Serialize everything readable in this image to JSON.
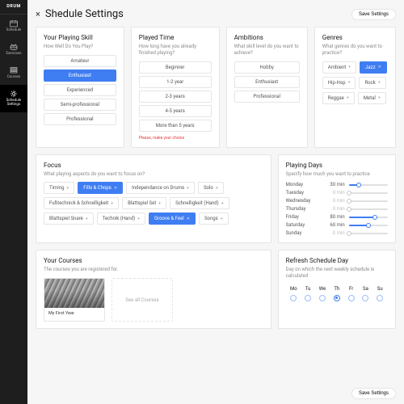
{
  "sidebar": {
    "logo": "DRUM",
    "items": [
      {
        "label": "Schedule"
      },
      {
        "label": "Exercises"
      },
      {
        "label": "Courses"
      },
      {
        "label": "Schedule\nSettings"
      }
    ]
  },
  "header": {
    "title": "Shedule Settings",
    "save_label": "Save Settings"
  },
  "skill": {
    "title": "Your Playing Skill",
    "subtitle": "How Well Do You Play?",
    "options": [
      "Amateur",
      "Enthusiast",
      "Experienced",
      "Semi-professional",
      "Professional"
    ],
    "selected": "Enthusiast"
  },
  "played": {
    "title": "Played Time",
    "subtitle": "How long have you already finished playing?",
    "options": [
      "Beginner",
      "1-2 year",
      "2-3 years",
      "4-5 years",
      "More than 5 years"
    ],
    "required_note": "Please, make your choice"
  },
  "ambitions": {
    "title": "Ambitions",
    "subtitle": "What skill level do you want to achieve?",
    "options": [
      "Hobby",
      "Enthusiast",
      "Professional"
    ]
  },
  "genres": {
    "title": "Genres",
    "subtitle": "What genres do you want to practice?",
    "tags": [
      {
        "label": "Ambient",
        "selected": false
      },
      {
        "label": "Jazz",
        "selected": true
      },
      {
        "label": "Hip-Hop",
        "selected": false
      },
      {
        "label": "Rock",
        "selected": false
      },
      {
        "label": "Reggae",
        "selected": false
      },
      {
        "label": "Metal",
        "selected": false
      }
    ]
  },
  "focus": {
    "title": "Focus",
    "subtitle": "What playing aspects do you want to focus on?",
    "tags": [
      {
        "label": "Timing",
        "selected": false
      },
      {
        "label": "Fills & Chops",
        "selected": true
      },
      {
        "label": "Independance on Drums",
        "selected": false
      },
      {
        "label": "Solo",
        "selected": false
      },
      {
        "label": "Fußtechnick & Schnelligkeit",
        "selected": false
      },
      {
        "label": "Blattspiel Set",
        "selected": false
      },
      {
        "label": "Schnelligkeit (Hand)",
        "selected": false
      },
      {
        "label": "Blattspiel Snare",
        "selected": false
      },
      {
        "label": "Technik (Hand)",
        "selected": false
      },
      {
        "label": "Groove & Feel",
        "selected": true
      },
      {
        "label": "Songs",
        "selected": false
      }
    ]
  },
  "days": {
    "title": "Playing Days",
    "subtitle": "Specify how much you want to practice",
    "unit": "min",
    "max": 120,
    "rows": [
      {
        "day": "Monday",
        "minutes": 30
      },
      {
        "day": "Tuesday",
        "minutes": 0
      },
      {
        "day": "Wednesday",
        "minutes": 0
      },
      {
        "day": "Thursday",
        "minutes": 0
      },
      {
        "day": "Friday",
        "minutes": 80
      },
      {
        "day": "Saturday",
        "minutes": 60
      },
      {
        "day": "Sunday",
        "minutes": 0
      }
    ]
  },
  "courses": {
    "title": "Your Courses",
    "subtitle": "The courses you are registered for.",
    "items": [
      {
        "title": "My First Year"
      }
    ],
    "see_all": "See all Courses"
  },
  "refresh": {
    "title": "Refresh Schedule Day",
    "subtitle": "Day on which the next weekly schedule is calculated",
    "days": [
      "Mo",
      "Tu",
      "We",
      "Th",
      "Fr",
      "Sa",
      "Su"
    ],
    "selected": "Th"
  },
  "bottom_save": "Save Settings"
}
